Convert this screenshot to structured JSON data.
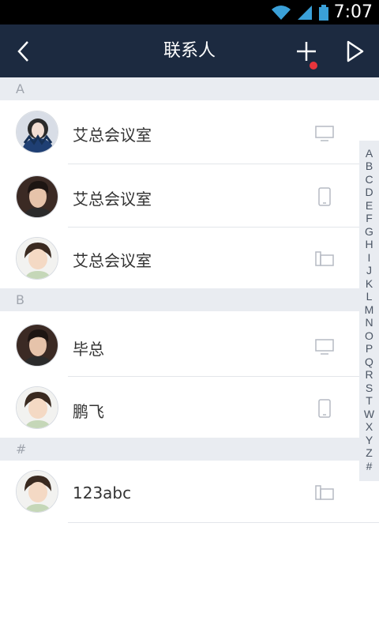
{
  "status_bar": {
    "time": "7:07"
  },
  "header": {
    "title": "联系人",
    "add_badge_color": "#e8353c"
  },
  "sections": [
    {
      "letter": "A",
      "contacts": [
        {
          "name": "艾总会议室",
          "avatar": "woman-scarf-avatar",
          "device": "monitor-icon"
        },
        {
          "name": "艾总会议室",
          "avatar": "man-avatar",
          "device": "phone-icon"
        },
        {
          "name": "艾总会议室",
          "avatar": "child-avatar",
          "device": "deskphone-icon"
        }
      ]
    },
    {
      "letter": "B",
      "contacts": [
        {
          "name": "毕总",
          "avatar": "man-avatar",
          "device": "monitor-icon"
        },
        {
          "name": "鹏飞",
          "avatar": "child-avatar",
          "device": "phone-icon"
        }
      ]
    },
    {
      "letter": "#",
      "contacts": [
        {
          "name": "123abc",
          "avatar": "child-avatar",
          "device": "deskphone-icon"
        }
      ]
    }
  ],
  "index_letters": [
    "A",
    "B",
    "C",
    "D",
    "E",
    "F",
    "G",
    "H",
    "I",
    "J",
    "K",
    "L",
    "M",
    "N",
    "O",
    "P",
    "Q",
    "R",
    "S",
    "T",
    "W",
    "X",
    "Y",
    "Z",
    "#"
  ],
  "colors": {
    "header_bg": "#1c2a40",
    "section_bg": "#e9ecf1",
    "text": "#333333"
  }
}
